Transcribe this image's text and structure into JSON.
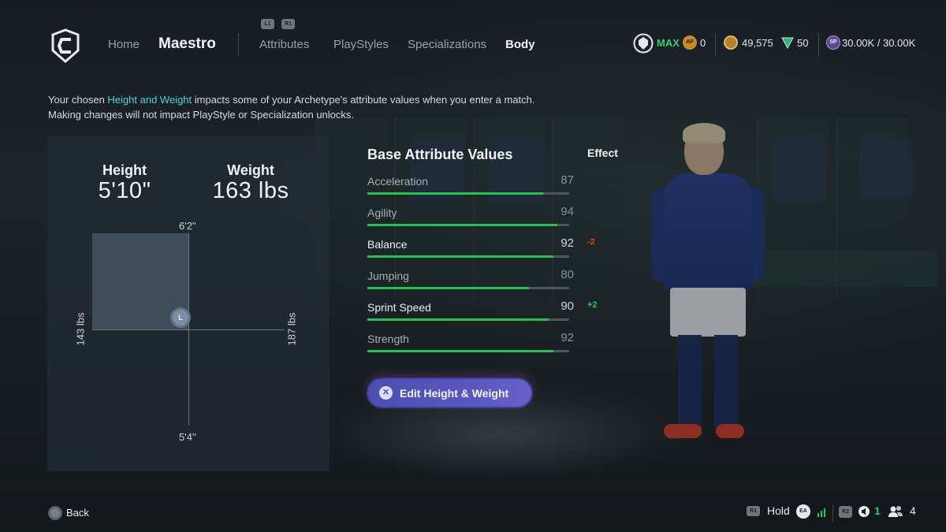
{
  "header": {
    "title": "Maestro",
    "nav": [
      "Home",
      "Attributes",
      "PlayStyles",
      "Specializations",
      "Body"
    ],
    "active_tab": "Body",
    "shoulder_left": "L1",
    "shoulder_right": "R1",
    "currencies": {
      "ovr_label": "MAX",
      "ap_badge": "AP",
      "ap_value": "0",
      "coins": "49,575",
      "points": "50",
      "sp_badge": "SP",
      "sp_value": "30.00K / 30.00K"
    }
  },
  "intro": {
    "line1_before": "Your chosen ",
    "line1_link": "Height and Weight",
    "line1_after": " impacts some of your Archetype's attribute values when you enter a match.",
    "line2": "Making changes will not impact PlayStyle or Specialization unlocks."
  },
  "body": {
    "height_label": "Height",
    "height_value": "5'10\"",
    "weight_label": "Weight",
    "weight_value": "163 lbs",
    "axis_top": "6'2\"",
    "axis_bottom": "5'4\"",
    "axis_left": "143 lbs",
    "axis_right": "187 lbs",
    "marker": "L"
  },
  "attributes": {
    "title": "Base Attribute Values",
    "effect_title": "Effect",
    "rows": [
      {
        "name": "Acceleration",
        "value": "87",
        "fill": 0.87,
        "seg": 0,
        "effect": "",
        "highlight": false
      },
      {
        "name": "Agility",
        "value": "94",
        "fill": 0.94,
        "seg": 0,
        "effect": "",
        "highlight": false
      },
      {
        "name": "Balance",
        "value": "92",
        "fill": 0.92,
        "seg": 0,
        "effect": "-2",
        "highlight": true
      },
      {
        "name": "Jumping",
        "value": "80",
        "fill": 0.8,
        "seg": 0,
        "effect": "",
        "highlight": false
      },
      {
        "name": "Sprint Speed",
        "value": "90",
        "fill": 0.9,
        "seg": 0,
        "effect": "+2",
        "highlight": true
      },
      {
        "name": "Strength",
        "value": "92",
        "fill": 0.92,
        "seg": 0,
        "effect": "",
        "highlight": false
      }
    ],
    "effect_colors": {
      "negative": "#e0402c",
      "positive": "#29c85a"
    }
  },
  "edit_button": {
    "icon": "✕",
    "label": "Edit Height & Weight"
  },
  "footer": {
    "back_label": "Back",
    "hold_badge": "R1",
    "hold_label": "Hold",
    "ea_badge": "EA",
    "r2_badge": "R2",
    "voice_count": "1",
    "players_count": "4"
  }
}
